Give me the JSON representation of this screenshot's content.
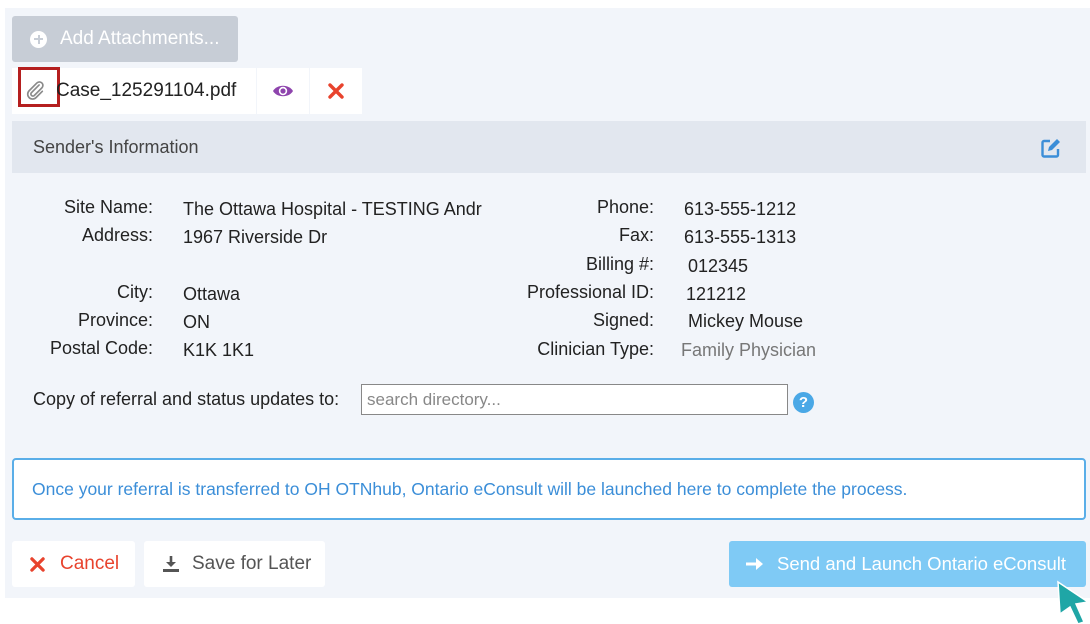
{
  "attachments": {
    "add_label": "Add Attachments...",
    "file_name": "Case_125291104.pdf"
  },
  "sender": {
    "header": "Sender's Information",
    "left_fields": [
      {
        "label": "Site Name:",
        "value": "The Ottawa Hospital - TESTING Andr"
      },
      {
        "label": "Address:",
        "value": "1967 Riverside Dr"
      },
      {
        "label": "City:",
        "value": "Ottawa"
      },
      {
        "label": "Province:",
        "value": "ON"
      },
      {
        "label": "Postal Code:",
        "value": "K1K 1K1"
      }
    ],
    "right_fields": [
      {
        "label": "Phone:",
        "value": "613-555-1212"
      },
      {
        "label": "Fax:",
        "value": "613-555-1313"
      },
      {
        "label": "Billing #:",
        "value": "012345"
      },
      {
        "label": "Professional ID:",
        "value": "121212"
      },
      {
        "label": "Signed:",
        "value": "Mickey Mouse"
      },
      {
        "label": "Clinician Type:",
        "value": "Family Physician"
      }
    ],
    "copy_label": "Copy of referral and status updates to:",
    "copy_placeholder": "search directory...",
    "help_glyph": "?"
  },
  "info_message": "Once your referral is transferred to OH OTNhub, Ontario eConsult will be launched here to complete the process.",
  "actions": {
    "cancel_label": "Cancel",
    "save_label": "Save for Later",
    "send_label": "Send and Launch Ontario eConsult"
  },
  "colors": {
    "accent": "#3b8ed8",
    "danger": "#e8432d",
    "send_button": "#7fcaf5",
    "highlight_box": "#b51f1f",
    "cursor": "#1fa6a6"
  }
}
